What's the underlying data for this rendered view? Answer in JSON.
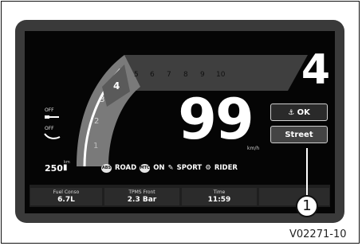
{
  "gear": "4",
  "tach": {
    "inner_ticks": [
      "1",
      "2",
      "3",
      "4"
    ],
    "top_ticks": [
      "5",
      "6",
      "7",
      "8",
      "9",
      "10"
    ]
  },
  "speed": {
    "value": "99",
    "unit": "km/h"
  },
  "indicators": {
    "off_top": "OFF",
    "off_bottom": "OFF"
  },
  "buttons": {
    "ok_label": "OK",
    "mode_label": "Street"
  },
  "range": {
    "value": "250",
    "unit": "km"
  },
  "modes": {
    "abs": "ABS",
    "road": "ROAD",
    "mtc": "MTC",
    "on": "ON",
    "sport": "SPORT",
    "rider": "RIDER"
  },
  "info_cells": [
    {
      "title": "Fuel Conso",
      "value": "6.7L"
    },
    {
      "title": "TPMS Front",
      "value": "2.3 Bar"
    },
    {
      "title": "Time",
      "value": "11:59"
    },
    {
      "title": "",
      "value": ""
    }
  ],
  "callout": "1",
  "figure_ref": "V02271-10",
  "colors": {
    "screen_bg": "#050505",
    "bezel": "#3a3a3a",
    "text": "#ffffff"
  },
  "icons": [
    "headlight-icon",
    "wiper-icon",
    "fuel-icon",
    "abs-icon",
    "mtc-icon",
    "sport-icon",
    "rider-icon",
    "ok-icon"
  ]
}
